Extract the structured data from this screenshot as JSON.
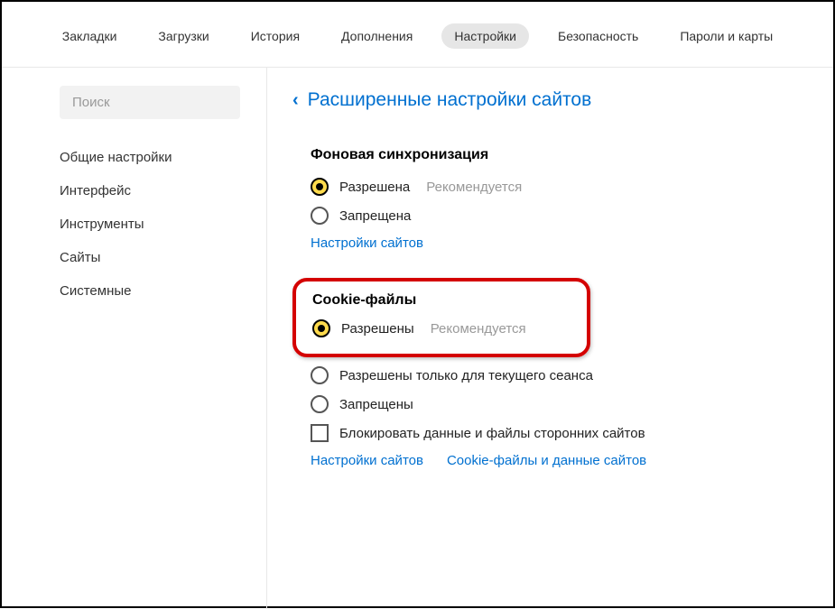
{
  "topnav": {
    "items": [
      {
        "label": "Закладки"
      },
      {
        "label": "Загрузки"
      },
      {
        "label": "История"
      },
      {
        "label": "Дополнения"
      },
      {
        "label": "Настройки",
        "active": true
      },
      {
        "label": "Безопасность"
      },
      {
        "label": "Пароли и карты"
      }
    ]
  },
  "search": {
    "placeholder": "Поиск"
  },
  "sidebar": {
    "items": [
      {
        "label": "Общие настройки"
      },
      {
        "label": "Интерфейс"
      },
      {
        "label": "Инструменты"
      },
      {
        "label": "Сайты"
      },
      {
        "label": "Системные"
      }
    ]
  },
  "breadcrumb": {
    "title": "Расширенные настройки сайтов"
  },
  "sync": {
    "title": "Фоновая синхронизация",
    "allowed": "Разрешена",
    "recommended": "Рекомендуется",
    "denied": "Запрещена",
    "link": "Настройки сайтов"
  },
  "cookies": {
    "title": "Cookie-файлы",
    "allowed": "Разрешены",
    "recommended": "Рекомендуется",
    "session_only": "Разрешены только для текущего сеанса",
    "denied": "Запрещены",
    "block_third": "Блокировать данные и файлы сторонних сайтов",
    "link1": "Настройки сайтов",
    "link2": "Cookie-файлы и данные сайтов"
  }
}
